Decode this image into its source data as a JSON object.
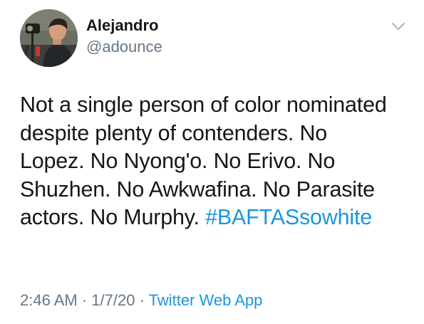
{
  "author": {
    "display_name": "Alejandro",
    "handle": "@adounce"
  },
  "icons": {
    "avatar": "profile-photo",
    "menu": "chevron-down-icon"
  },
  "tweet": {
    "lines": [
      "Not a single person of color nominated",
      "despite plenty of contenders. No",
      "Lopez. No Nyong'o. No Erivo. No",
      "Shuzhen. No Awkwafina. No Parasite",
      "actors. No Murphy. "
    ],
    "hashtag": "#BAFTASsowhite"
  },
  "meta": {
    "time": "2:46 AM",
    "sep1": " · ",
    "date": "1/7/20",
    "sep2": " · ",
    "app": "Twitter Web App"
  },
  "colors": {
    "text": "#14171a",
    "secondary": "#657786",
    "link": "#1b95e0",
    "background": "#ffffff"
  }
}
